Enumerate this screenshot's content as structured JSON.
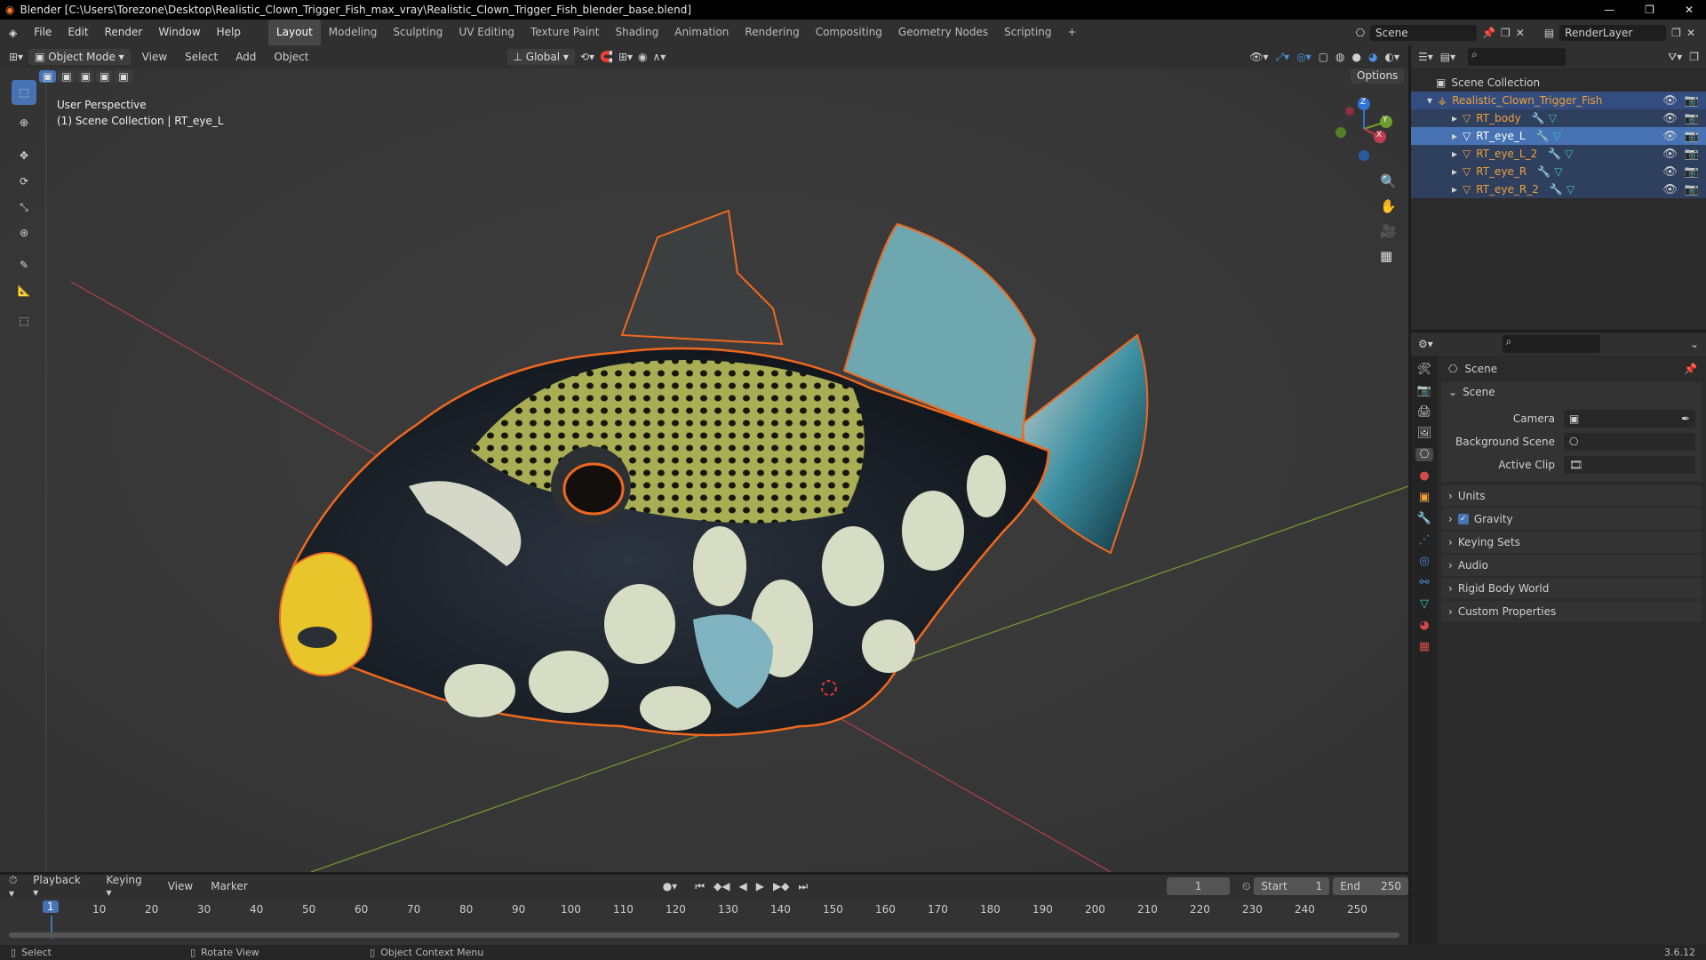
{
  "window": {
    "title": "Blender [C:\\Users\\Torezone\\Desktop\\Realistic_Clown_Trigger_Fish_max_vray\\Realistic_Clown_Trigger_Fish_blender_base.blend]",
    "minimize": "—",
    "maximize": "❐",
    "close": "✕"
  },
  "menus": [
    "File",
    "Edit",
    "Render",
    "Window",
    "Help"
  ],
  "workspaces": [
    "Layout",
    "Modeling",
    "Sculpting",
    "UV Editing",
    "Texture Paint",
    "Shading",
    "Animation",
    "Rendering",
    "Compositing",
    "Geometry Nodes",
    "Scripting"
  ],
  "add_workspace": "+",
  "scene": {
    "name": "Scene",
    "layer": "RenderLayer"
  },
  "viewport": {
    "mode": "Object Mode",
    "menus": [
      "View",
      "Select",
      "Add",
      "Object"
    ],
    "orientation": "Global",
    "options": "Options",
    "overlay_line1": "User Perspective",
    "overlay_line2": "(1) Scene Collection | RT_eye_L",
    "gizmo": {
      "x": "X",
      "y": "Y",
      "z": "Z"
    }
  },
  "outliner": {
    "root": "Scene Collection",
    "collection": "Realistic_Clown_Trigger_Fish",
    "items": [
      {
        "name": "RT_body",
        "selected": false
      },
      {
        "name": "RT_eye_L",
        "selected": true
      },
      {
        "name": "RT_eye_L_2",
        "selected": false
      },
      {
        "name": "RT_eye_R",
        "selected": false
      },
      {
        "name": "RT_eye_R_2",
        "selected": false
      }
    ]
  },
  "properties": {
    "context": "Scene",
    "panel": "Scene",
    "fields": [
      {
        "label": "Camera"
      },
      {
        "label": "Background Scene"
      },
      {
        "label": "Active Clip"
      }
    ],
    "sections": [
      "Units",
      "Gravity",
      "Keying Sets",
      "Audio",
      "Rigid Body World",
      "Custom Properties"
    ],
    "gravity_checked": true
  },
  "timeline": {
    "menus": [
      "Playback",
      "Keying",
      "View",
      "Marker"
    ],
    "current_frame": "1",
    "start_label": "Start",
    "start": "1",
    "end_label": "End",
    "end": "250",
    "ticks": [
      "1",
      "10",
      "20",
      "30",
      "40",
      "50",
      "60",
      "70",
      "80",
      "90",
      "100",
      "110",
      "120",
      "130",
      "140",
      "150",
      "160",
      "170",
      "180",
      "190",
      "200",
      "210",
      "220",
      "230",
      "240",
      "250"
    ]
  },
  "statusbar": {
    "select": "Select",
    "rotate": "Rotate View",
    "context": "Object Context Menu",
    "version": "3.6.12"
  },
  "colors": {
    "accent": "#4772b3",
    "selection_outline": "#f0681e",
    "x_axis": "#c33c4c",
    "y_axis": "#6f9e2d",
    "z_axis": "#2f73d6"
  }
}
